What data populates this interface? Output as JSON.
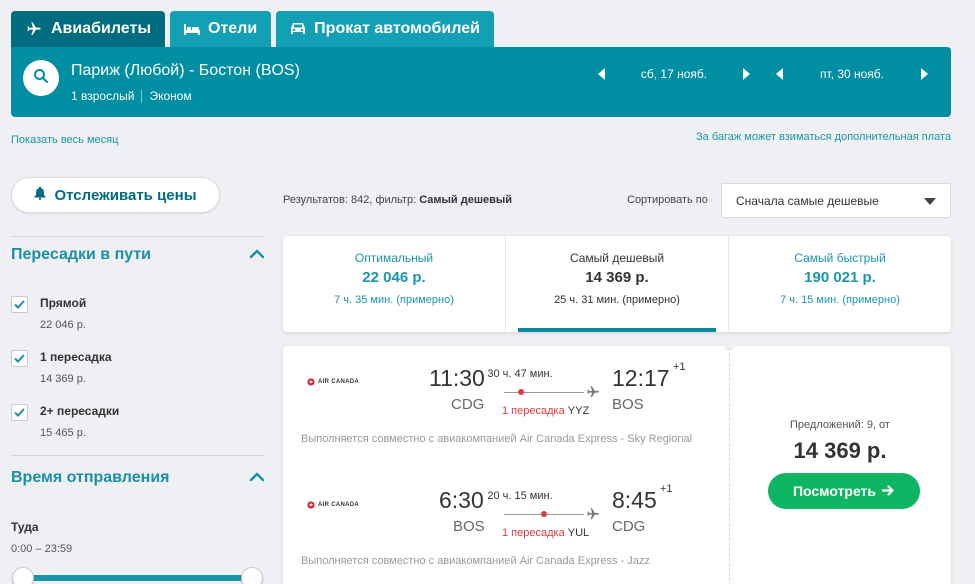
{
  "tabs": [
    {
      "label": "Авиабилеты",
      "icon": "plane-icon",
      "active": true
    },
    {
      "label": "Отели",
      "icon": "bed-icon",
      "active": false
    },
    {
      "label": "Прокат автомобилей",
      "icon": "car-icon",
      "active": false
    }
  ],
  "search": {
    "route": "Париж (Любой) - Бостон (BOS)",
    "passengers": "1 взрослый",
    "cabin": "Эконом",
    "depart_date": "сб, 17 нояб.",
    "return_date": "пт, 30 нояб."
  },
  "links": {
    "show_month": "Показать весь месяц",
    "baggage_note": "За багаж может взиматься дополнительная плата"
  },
  "sidebar": {
    "track_prices": "Отслеживать цены",
    "stops_title": "Пересадки в пути",
    "stops": [
      {
        "label": "Прямой",
        "price": "22 046 р.",
        "checked": true
      },
      {
        "label": "1 пересадка",
        "price": "14 369 р.",
        "checked": true
      },
      {
        "label": "2+ пересадки",
        "price": "15 465 р.",
        "checked": true
      }
    ],
    "departure_title": "Время отправления",
    "departure_label": "Туда",
    "departure_range": "0:00 – 23:59"
  },
  "results": {
    "count_prefix": "Результатов: 842, фильтр: ",
    "filter_name": "Самый дешевый",
    "sort_label": "Сортировать по",
    "sort_value": "Сначала самые дешевые"
  },
  "price_tabs": [
    {
      "title": "Оптимальный",
      "price": "22 046 р.",
      "duration": "7 ч. 35 мин. (примерно)",
      "active": false
    },
    {
      "title": "Самый дешевый",
      "price": "14 369 р.",
      "duration": "25 ч. 31 мин. (примерно)",
      "active": true
    },
    {
      "title": "Самый быстрый",
      "price": "190 021 р.",
      "duration": "7 ч. 15 мин. (примерно)",
      "active": false
    }
  ],
  "result_card": {
    "legs": [
      {
        "airline": "AIR CANADA",
        "depart_time": "11:30",
        "depart_code": "CDG",
        "arrive_time": "12:17",
        "arrive_code": "BOS",
        "day_offset": "+1",
        "duration": "30 ч. 47 мин.",
        "stops": "1 пересадка",
        "via": "YYZ",
        "note": "Выполняется совместно с авиакомпанией Air Canada Express - Sky Regional"
      },
      {
        "airline": "AIR CANADA",
        "depart_time": "6:30",
        "depart_code": "BOS",
        "arrive_time": "8:45",
        "arrive_code": "CDG",
        "day_offset": "+1",
        "duration": "20 ч. 15 мин.",
        "stops": "1 пересадка",
        "via": "YUL",
        "note": "Выполняется совместно с авиакомпанией Air Canada Express - Jazz"
      }
    ],
    "offers": "Предложений: 9, от",
    "price": "14 369 р.",
    "view_button": "Посмотреть"
  },
  "colors": {
    "brand_dark": "#006c80",
    "brand": "#008ea3",
    "accent_link": "#1a95ab",
    "cta_green": "#0eb664",
    "stop_red": "#e0393e"
  }
}
